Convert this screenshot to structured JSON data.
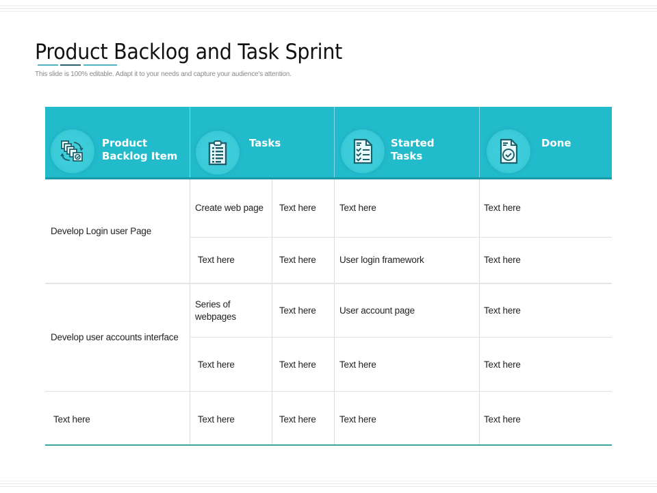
{
  "slide": {
    "title": "Product Backlog and Task Sprint",
    "subtitle": "This slide is 100% editable. Adapt it to your needs and capture your audience's attention.",
    "underline_colors": [
      "#4fb3c0",
      "#2a5f6b",
      "#4fb3c0"
    ]
  },
  "colors": {
    "header_bg": "#22bbcc",
    "header_border": "#1a99a8",
    "bottom_rule": "#3aa6a4",
    "icon_stroke": "#1d5f6a"
  },
  "table": {
    "headers": [
      {
        "label_line1": "Product",
        "label_line2": "Backlog Item",
        "icon": "backlog-items-icon"
      },
      {
        "label_line1": "Tasks",
        "label_line2": "",
        "icon": "clipboard-list-icon"
      },
      {
        "label_line1": "Started",
        "label_line2": "Tasks",
        "icon": "checklist-document-icon"
      },
      {
        "label_line1": "Done",
        "label_line2": "",
        "icon": "document-check-icon"
      }
    ],
    "groups": [
      {
        "backlog_item": "Develop Login user Page",
        "rows": [
          {
            "task": "Create web page",
            "task_detail": "Text here",
            "started": "Text here",
            "done": "Text here"
          },
          {
            "task": "Text here",
            "task_detail": "Text here",
            "started": "User login framework",
            "done": "Text here"
          }
        ]
      },
      {
        "backlog_item": "Develop user accounts interface",
        "rows": [
          {
            "task": "Series of webpages",
            "task_line1": "Series of",
            "task_line2": "webpages",
            "task_detail": "Text here",
            "started": "User account page",
            "done": "Text here"
          },
          {
            "task": "Text here",
            "task_detail": "Text here",
            "started": "Text here",
            "done": "Text here"
          }
        ]
      },
      {
        "backlog_item": "Text here",
        "rows": [
          {
            "task": "Text here",
            "task_detail": "Text here",
            "started": "Text here",
            "done": "Text here"
          }
        ]
      }
    ]
  }
}
